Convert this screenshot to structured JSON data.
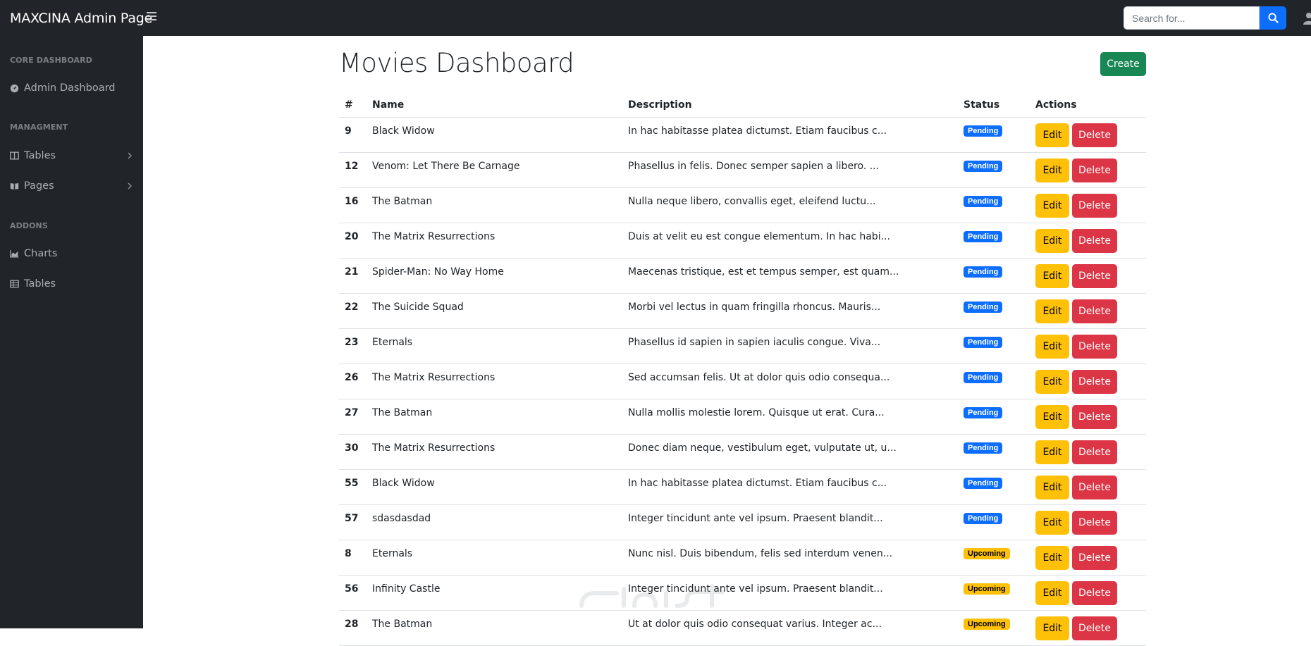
{
  "topbar": {
    "brand": "MAXCINA Admin Page",
    "search_placeholder": "Search for..."
  },
  "sidebar": {
    "sections": [
      {
        "heading": "CORE DASHBOARD",
        "items": [
          {
            "label": "Admin Dashboard",
            "icon": "dashboard-gauge-icon"
          }
        ]
      },
      {
        "heading": "MANAGMENT",
        "items": [
          {
            "label": "Tables",
            "icon": "columns-icon",
            "chevron": true
          },
          {
            "label": "Pages",
            "icon": "book-open-icon",
            "chevron": true
          }
        ]
      },
      {
        "heading": "ADDONS",
        "items": [
          {
            "label": "Charts",
            "icon": "area-chart-icon"
          },
          {
            "label": "Tables",
            "icon": "table-icon"
          }
        ]
      }
    ]
  },
  "main": {
    "title": "Movies Dashboard",
    "create_label": "Create",
    "table": {
      "headers": [
        "#",
        "Name",
        "Description",
        "Status",
        "Actions"
      ],
      "edit_label": "Edit",
      "delete_label": "Delete",
      "rows": [
        {
          "id": "9",
          "name": "Black Widow",
          "description": "In hac habitasse platea dictumst. Etiam faucibus c...",
          "status": "Pending"
        },
        {
          "id": "12",
          "name": "Venom: Let There Be Carnage",
          "description": "Phasellus in felis. Donec semper sapien a libero. ...",
          "status": "Pending"
        },
        {
          "id": "16",
          "name": "The Batman",
          "description": "Nulla neque libero, convallis eget, eleifend luctu...",
          "status": "Pending"
        },
        {
          "id": "20",
          "name": "The Matrix Resurrections",
          "description": "Duis at velit eu est congue elementum. In hac habi...",
          "status": "Pending"
        },
        {
          "id": "21",
          "name": "Spider-Man: No Way Home",
          "description": "Maecenas tristique, est et tempus semper, est quam...",
          "status": "Pending"
        },
        {
          "id": "22",
          "name": "The Suicide Squad",
          "description": "Morbi vel lectus in quam fringilla rhoncus. Mauris...",
          "status": "Pending"
        },
        {
          "id": "23",
          "name": "Eternals",
          "description": "Phasellus id sapien in sapien iaculis congue. Viva...",
          "status": "Pending"
        },
        {
          "id": "26",
          "name": "The Matrix Resurrections",
          "description": "Sed accumsan felis. Ut at dolor quis odio consequa...",
          "status": "Pending"
        },
        {
          "id": "27",
          "name": "The Batman",
          "description": "Nulla mollis molestie lorem. Quisque ut erat. Cura...",
          "status": "Pending"
        },
        {
          "id": "30",
          "name": "The Matrix Resurrections",
          "description": "Donec diam neque, vestibulum eget, vulputate ut, u...",
          "status": "Pending"
        },
        {
          "id": "55",
          "name": "Black Widow",
          "description": "In hac habitasse platea dictumst. Etiam faucibus c...",
          "status": "Pending"
        },
        {
          "id": "57",
          "name": "sdasdasdad",
          "description": "Integer tincidunt ante vel ipsum. Praesent blandit...",
          "status": "Pending"
        },
        {
          "id": "8",
          "name": "Eternals",
          "description": "Nunc nisl. Duis bibendum, felis sed interdum venen...",
          "status": "Upcoming"
        },
        {
          "id": "56",
          "name": "Infinity Castle",
          "description": "Integer tincidunt ante vel ipsum. Praesent blandit...",
          "status": "Upcoming"
        },
        {
          "id": "28",
          "name": "The Batman",
          "description": "Ut at dolor quis odio consequat varius. Integer ac...",
          "status": "Upcoming"
        }
      ]
    }
  },
  "colors": {
    "topbar": "#212529",
    "pending_badge": "#0d6efd",
    "upcoming_badge": "#ffc107",
    "edit_button": "#ffc107",
    "delete_button": "#dc3545",
    "create_button": "#198754"
  }
}
